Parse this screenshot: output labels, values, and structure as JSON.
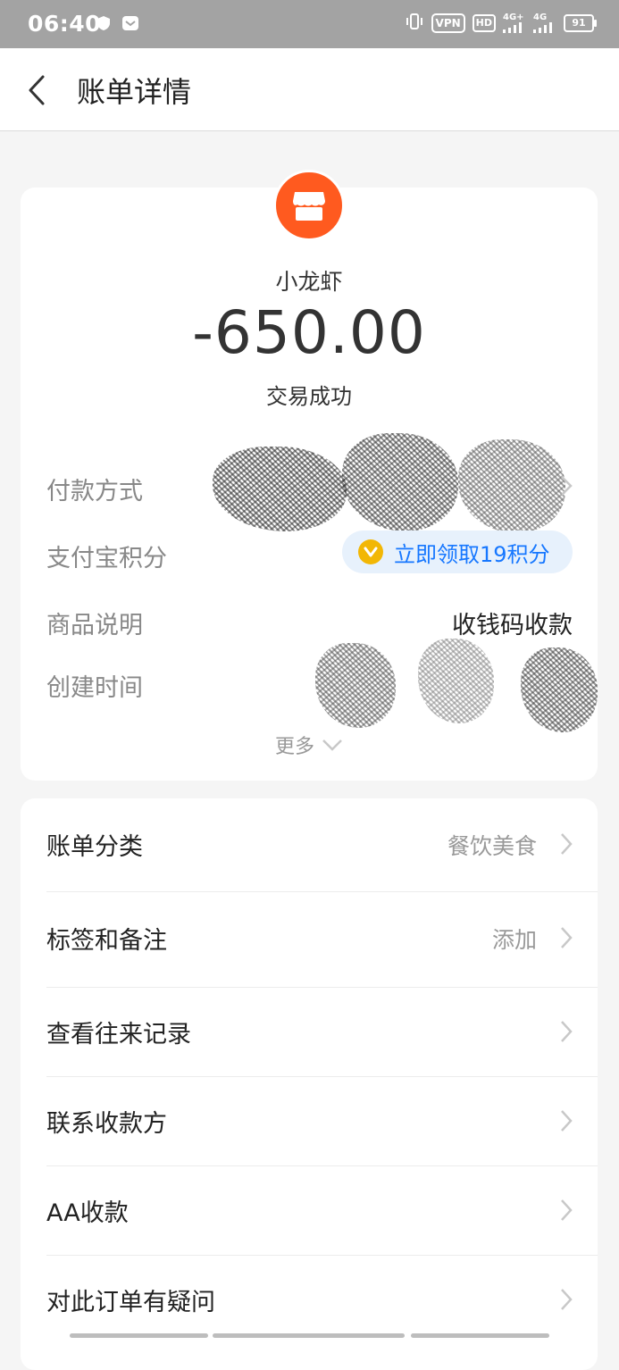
{
  "status_bar": {
    "time": "06:40",
    "vpn": "VPN",
    "hd": "HD",
    "network_a": "4G+",
    "network_b": "4G",
    "battery": "91"
  },
  "header": {
    "title": "账单详情"
  },
  "merchant": {
    "name": "小龙虾",
    "amount": "-650.00",
    "status": "交易成功",
    "logo_color": "#ff5a1f"
  },
  "info": {
    "payment_method_label": "付款方式",
    "points_label": "支付宝积分",
    "points_action": "立即领取19积分",
    "product_label": "商品说明",
    "product_value": "收钱码收款",
    "created_label": "创建时间",
    "more_label": "更多"
  },
  "list": [
    {
      "label": "账单分类",
      "value": "餐饮美食"
    },
    {
      "label": "标签和备注",
      "value": "添加"
    },
    {
      "label": "查看往来记录",
      "value": ""
    },
    {
      "label": "联系收款方",
      "value": ""
    },
    {
      "label": "AA收款",
      "value": ""
    },
    {
      "label": "对此订单有疑问",
      "value": ""
    }
  ],
  "colors": {
    "accent_blue": "#1677ff",
    "pill_bg": "#e7f1fc",
    "coin": "#f2b705"
  }
}
